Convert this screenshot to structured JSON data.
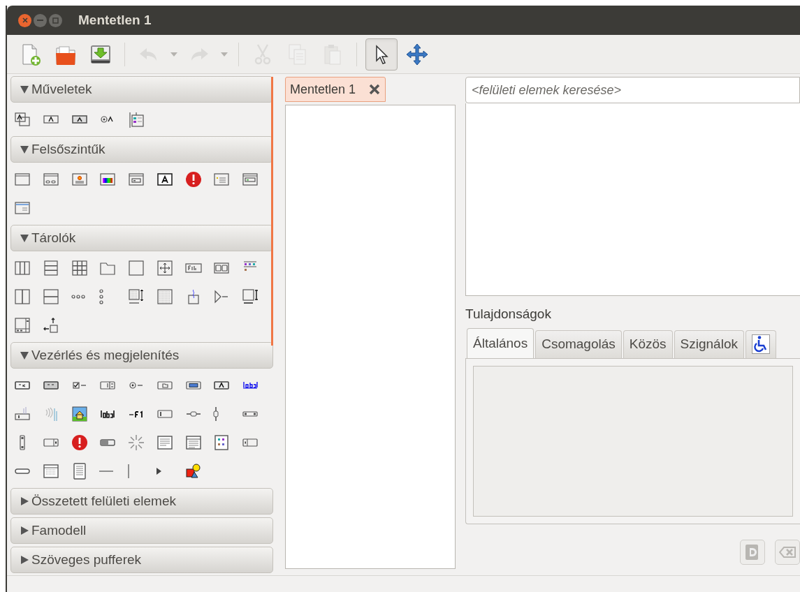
{
  "window": {
    "title": "Mentetlen 1"
  },
  "toolbar": [
    {
      "kind": "new",
      "disabled": false
    },
    {
      "kind": "open",
      "disabled": false
    },
    {
      "kind": "save",
      "disabled": false
    },
    {
      "kind": "separator"
    },
    {
      "kind": "undo",
      "disabled": true,
      "dropdown": true
    },
    {
      "kind": "redo",
      "disabled": true,
      "dropdown": true
    },
    {
      "kind": "separator"
    },
    {
      "kind": "cut",
      "disabled": true
    },
    {
      "kind": "copy",
      "disabled": true
    },
    {
      "kind": "paste",
      "disabled": true
    },
    {
      "kind": "separator"
    },
    {
      "kind": "pointer",
      "disabled": false,
      "selected": true
    },
    {
      "kind": "move",
      "disabled": false,
      "selected": false
    }
  ],
  "palette": [
    {
      "label": "Műveletek",
      "expanded": true,
      "items": [
        {
          "kind": "action-label"
        },
        {
          "kind": "action-button"
        },
        {
          "kind": "action-toggle"
        },
        {
          "kind": "action-radio"
        },
        {
          "kind": "action-group"
        }
      ]
    },
    {
      "label": "Felsőszintűk",
      "expanded": true,
      "items": [
        {
          "kind": "window"
        },
        {
          "kind": "dialog"
        },
        {
          "kind": "about"
        },
        {
          "kind": "color"
        },
        {
          "kind": "file-dialog"
        },
        {
          "kind": "font-dialog"
        },
        {
          "kind": "alert"
        },
        {
          "kind": "list-dialog"
        },
        {
          "kind": "entry-dialog"
        },
        {
          "kind": "offscreen"
        }
      ]
    },
    {
      "label": "Tárolók",
      "expanded": true,
      "items": [
        {
          "kind": "box-h"
        },
        {
          "kind": "box-v"
        },
        {
          "kind": "grid"
        },
        {
          "kind": "notebook"
        },
        {
          "kind": "frame"
        },
        {
          "kind": "fixed"
        },
        {
          "kind": "menubar"
        },
        {
          "kind": "buttonbox"
        },
        {
          "kind": "palette"
        },
        {
          "kind": "paned-h"
        },
        {
          "kind": "paned-v"
        },
        {
          "kind": "dots-h"
        },
        {
          "kind": "dots-v"
        },
        {
          "kind": "scrolled"
        },
        {
          "kind": "viewport"
        },
        {
          "kind": "event-box"
        },
        {
          "kind": "expander"
        },
        {
          "kind": "alignment"
        },
        {
          "kind": "statusbox"
        },
        {
          "kind": "overlay"
        }
      ]
    },
    {
      "label": "Vezérlés és megjelenítés",
      "expanded": true,
      "items": [
        {
          "kind": "button"
        },
        {
          "kind": "toggle"
        },
        {
          "kind": "check"
        },
        {
          "kind": "spin"
        },
        {
          "kind": "radio"
        },
        {
          "kind": "file-button"
        },
        {
          "kind": "color-button"
        },
        {
          "kind": "font-button"
        },
        {
          "kind": "link"
        },
        {
          "kind": "scale-button"
        },
        {
          "kind": "volume"
        },
        {
          "kind": "image"
        },
        {
          "kind": "label"
        },
        {
          "kind": "accel-label"
        },
        {
          "kind": "entry"
        },
        {
          "kind": "hscale"
        },
        {
          "kind": "vscale"
        },
        {
          "kind": "hscrollbar"
        },
        {
          "kind": "vscrollbar"
        },
        {
          "kind": "combo"
        },
        {
          "kind": "alert"
        },
        {
          "kind": "switch"
        },
        {
          "kind": "spinner"
        },
        {
          "kind": "textview"
        },
        {
          "kind": "treeview"
        },
        {
          "kind": "iconview"
        },
        {
          "kind": "combo-entry"
        },
        {
          "kind": "progress"
        },
        {
          "kind": "calendar"
        },
        {
          "kind": "list"
        },
        {
          "kind": "hsep"
        },
        {
          "kind": "vsep"
        },
        {
          "kind": "arrow"
        },
        {
          "kind": "drawing"
        }
      ]
    },
    {
      "label": "Összetett felületi elemek",
      "expanded": false
    },
    {
      "label": "Famodell",
      "expanded": false
    },
    {
      "label": "Szöveges pufferek",
      "expanded": false
    }
  ],
  "document_tabs": [
    {
      "label": "Mentetlen 1",
      "selected": true
    }
  ],
  "inspector": {
    "search": {
      "placeholder": "<felületi elemek keresése>"
    }
  },
  "properties": {
    "title": "Tulajdonságok",
    "tabs": [
      {
        "kind": "text",
        "label": "Általános",
        "selected": true
      },
      {
        "kind": "text",
        "label": "Csomagolás",
        "selected": false
      },
      {
        "kind": "text",
        "label": "Közös",
        "selected": false
      },
      {
        "kind": "text",
        "label": "Szignálok",
        "selected": false
      },
      {
        "kind": "accessibility",
        "selected": false
      }
    ],
    "buttons": [
      {
        "kind": "docs",
        "disabled": true
      },
      {
        "kind": "clear",
        "disabled": true
      }
    ]
  }
}
